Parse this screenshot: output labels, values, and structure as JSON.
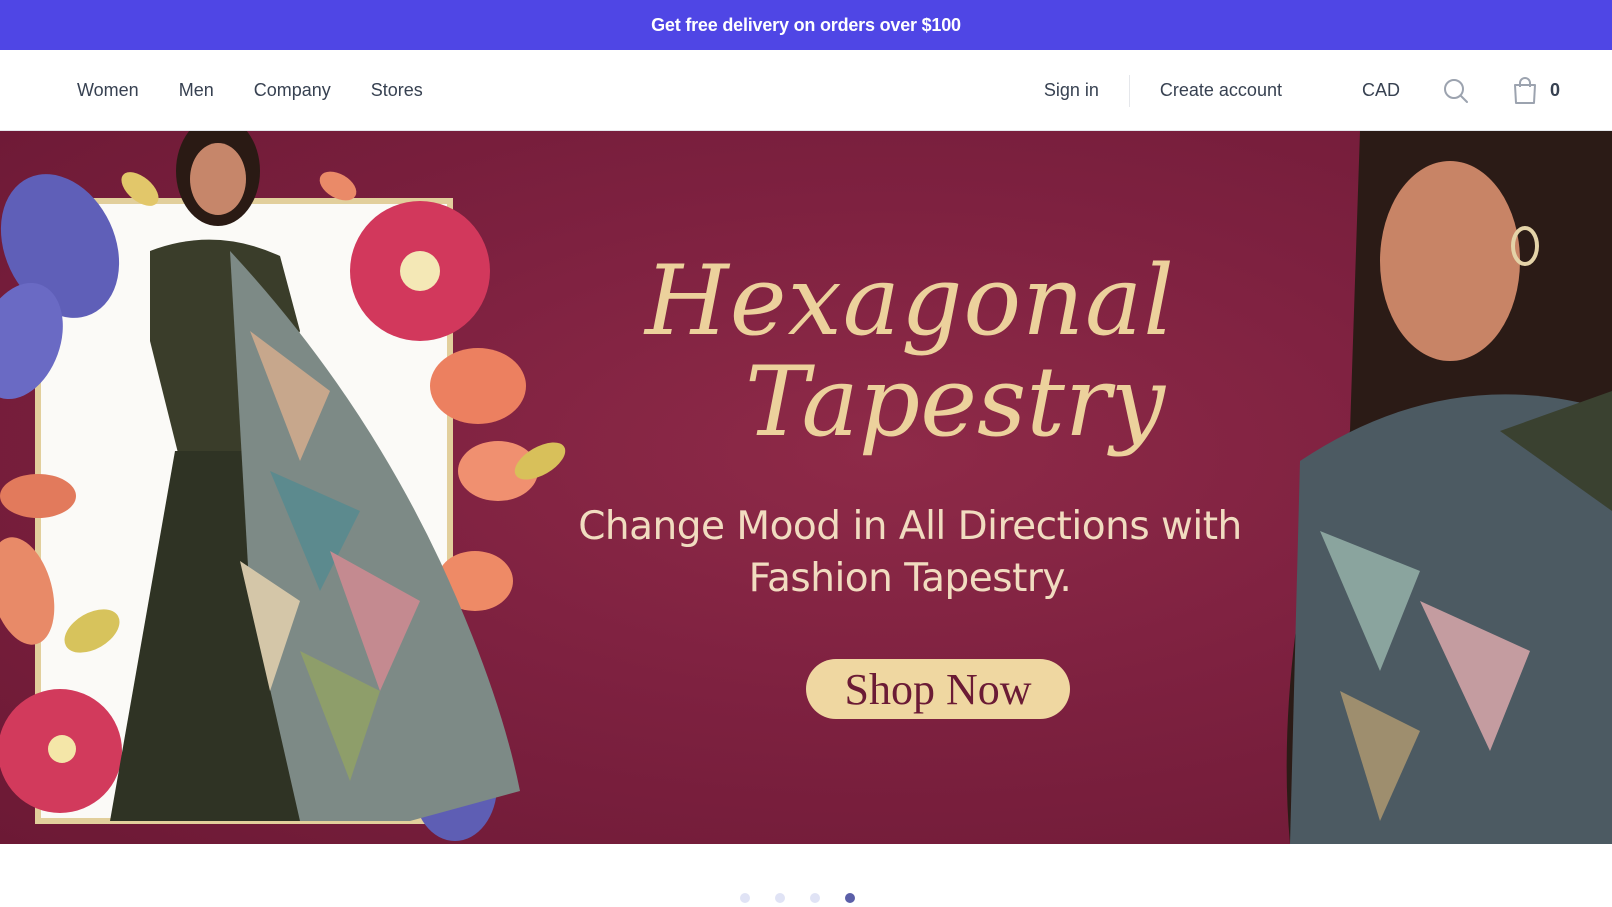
{
  "promo": {
    "text": "Get free delivery on orders over $100"
  },
  "nav": {
    "links": [
      "Women",
      "Men",
      "Company",
      "Stores"
    ],
    "sign_in": "Sign in",
    "create_account": "Create account",
    "currency": "CAD",
    "cart_count": "0"
  },
  "hero": {
    "title_line1": "Hexagonal",
    "title_line2": "Tapestry",
    "subtitle_line1": "Change Mood in All Directions with",
    "subtitle_line2": "Fashion Tapestry.",
    "cta": "Shop Now",
    "slide_count": 4,
    "active_slide": 4
  },
  "colors": {
    "promo_bg": "#4f46e5",
    "hero_bg": "#7e2140",
    "hero_title": "#ecd19c",
    "cta_bg": "#efd7a1"
  },
  "icons": [
    "search-icon",
    "shopping-bag-icon"
  ]
}
